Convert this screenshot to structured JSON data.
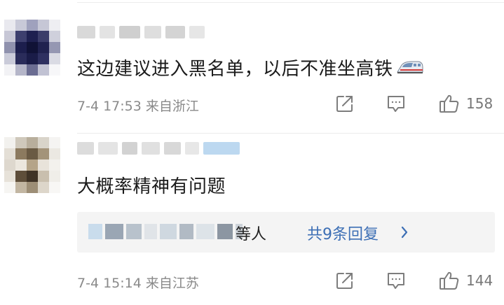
{
  "comments": [
    {
      "text": "这边建议进入黑名单，以后不准坐高铁",
      "emoji": "high-speed-train-icon",
      "date": "7-4",
      "time": "17:53",
      "location": "来自浙江",
      "likes": "158"
    },
    {
      "text": "大概率精神有问题",
      "date": "7-4",
      "time": "15:14",
      "location": "来自江苏",
      "likes": "144",
      "replies": {
        "people_suffix": "等人",
        "reply_count_label": "共9条回复"
      }
    }
  ],
  "colors": {
    "link": "#3d6fb5",
    "meta": "#8a8a8a",
    "reply_bg": "#f4f4f4"
  }
}
